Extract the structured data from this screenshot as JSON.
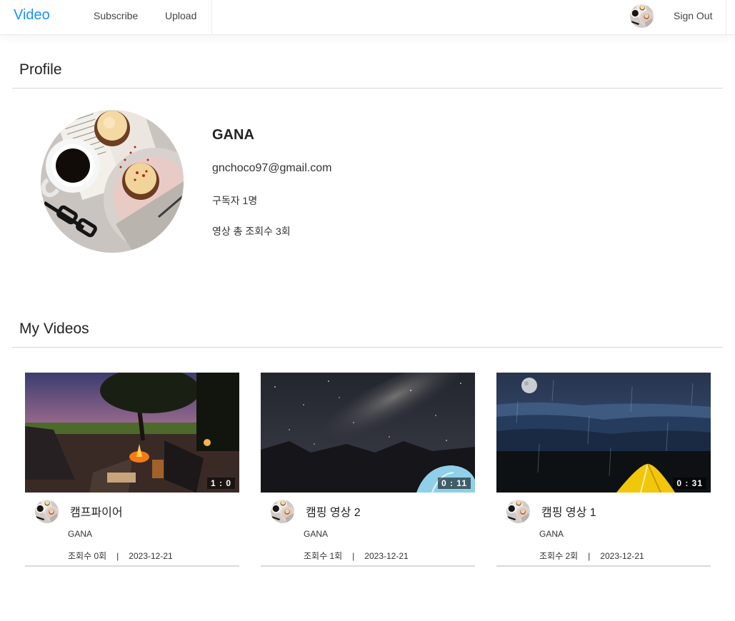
{
  "nav": {
    "brand": "Video",
    "links": [
      "Subscribe",
      "Upload"
    ],
    "sign_out": "Sign Out"
  },
  "profile": {
    "section_title": "Profile",
    "name": "GANA",
    "email": "gnchoco97@gmail.com",
    "subscribers": "구독자 1명",
    "total_views": "영상 총 조회수 3회"
  },
  "my_videos": {
    "section_title": "My Videos",
    "videos": [
      {
        "title": "캠프파이어",
        "author": "GANA",
        "views": "조회수 0회",
        "separator": "|",
        "date": "2023-12-21",
        "duration": "1 : 0",
        "thumbnail": "campfire-sunset"
      },
      {
        "title": "캠핑 영상 2",
        "author": "GANA",
        "views": "조회수 1회",
        "separator": "|",
        "date": "2023-12-21",
        "duration": "0 : 11",
        "thumbnail": "milky-way-tent"
      },
      {
        "title": "캠핑 영상 1",
        "author": "GANA",
        "views": "조회수 2회",
        "separator": "|",
        "date": "2023-12-21",
        "duration": "0 : 31",
        "thumbnail": "rainy-night-tent"
      }
    ]
  },
  "colors": {
    "brand": "#1890ff",
    "rule": "#d6d6d6"
  }
}
